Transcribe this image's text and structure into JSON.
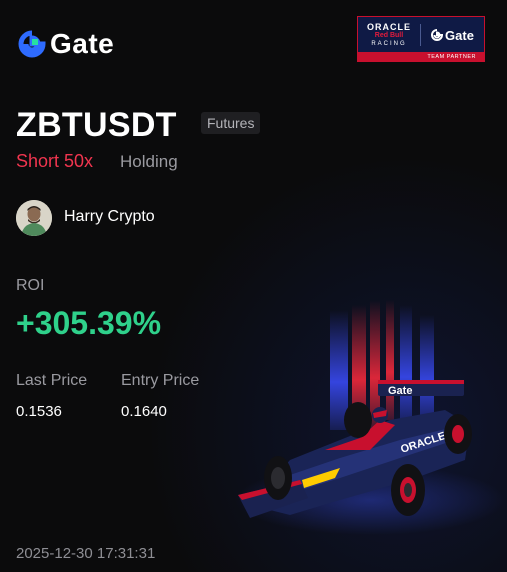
{
  "brand": {
    "name": "Gate",
    "color": "#ffffff",
    "icon": "gate-logo-icon"
  },
  "partner_badge": {
    "oracle": "ORACLE",
    "red_bull": "Red Bull",
    "racing": "RACING",
    "gate": "Gate",
    "footer": "TEAM PARTNER"
  },
  "position": {
    "symbol": "ZBTUSDT",
    "market_tag": "Futures",
    "side": "Short 50x",
    "status": "Holding"
  },
  "user": {
    "name": "Harry Crypto"
  },
  "metrics": {
    "roi_label": "ROI",
    "roi_value": "+305.39%",
    "last_price_label": "Last Price",
    "last_price": "0.1536",
    "entry_price_label": "Entry Price",
    "entry_price": "0.1640"
  },
  "timestamp": "2025-12-30 17:31:31",
  "colors": {
    "background": "#0b0b0c",
    "short": "#f0354f",
    "roi_positive": "#2fd18b",
    "muted": "#9a9aa0",
    "partner_red": "#c8102e",
    "partner_navy": "#0f1a45"
  }
}
